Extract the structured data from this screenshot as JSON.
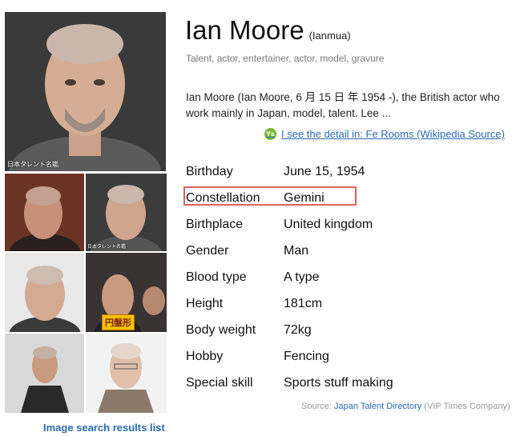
{
  "profile": {
    "name": "Ian Moore",
    "alias": "(Ianmua)",
    "occupations": "Talent, actor, entertainer, actor, model, gravure",
    "summary": "Ian Moore (Ian Moore, 6 月 15 日 年 1954 -), the British actor who work mainly in Japan, model, talent. Lee ...",
    "detail_link": "I see the detail in: Fe Rooms (Wikipedia Source)",
    "detail_icon_text": "Ys"
  },
  "photos": {
    "main_caption": "日本タレント名鑑",
    "thumb2_caption": "日本タレント名鑑",
    "thumb4_tag": "円盤形",
    "image_search_link": "Image search results list"
  },
  "attributes": [
    {
      "key": "Birthday",
      "value": "June 15, 1954"
    },
    {
      "key": "Constellation",
      "value": "Gemini"
    },
    {
      "key": "Birthplace",
      "value": "United kingdom"
    },
    {
      "key": "Gender",
      "value": "Man"
    },
    {
      "key": "Blood type",
      "value": "A type"
    },
    {
      "key": "Height",
      "value": "181cm"
    },
    {
      "key": "Body weight",
      "value": "72kg"
    },
    {
      "key": "Hobby",
      "value": "Fencing"
    },
    {
      "key": "Special skill",
      "value": "Sports stuff making"
    }
  ],
  "source": {
    "label": "Source:",
    "link": "Japan Talent Directory",
    "company": "(VIP Times Company)"
  },
  "colors": {
    "link": "#2a6ab7",
    "highlight_border": "#e06060"
  }
}
